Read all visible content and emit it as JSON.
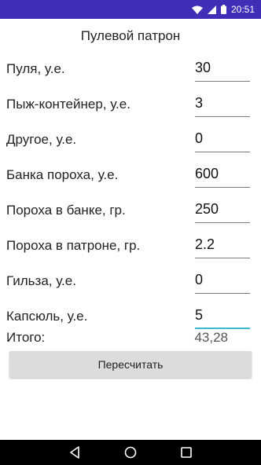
{
  "status_bar": {
    "time": "20:51"
  },
  "title": "Пулевой патрон",
  "rows": [
    {
      "label": "Пуля, у.е.",
      "value": "30"
    },
    {
      "label": "Пыж-контейнер, у.е.",
      "value": "3"
    },
    {
      "label": "Другое, у.е.",
      "value": "0"
    },
    {
      "label": "Банка пороха, у.е.",
      "value": "600"
    },
    {
      "label": "Пороха в банке, гр.",
      "value": "250"
    },
    {
      "label": "Пороха в патроне, гр.",
      "value": "2.2"
    },
    {
      "label": "Гильза, у.е.",
      "value": "0"
    },
    {
      "label": "Капсюль, у.е.",
      "value": "5"
    }
  ],
  "total": {
    "label": "Итого:",
    "value": "43,28"
  },
  "button": {
    "label": "Пересчитать"
  },
  "colors": {
    "status_bar": "#3f2fb6",
    "focus_underline": "#3fb9cf"
  },
  "icons": [
    "wifi-icon",
    "signal-icon",
    "battery-icon",
    "back-icon",
    "home-icon",
    "recents-icon"
  ]
}
